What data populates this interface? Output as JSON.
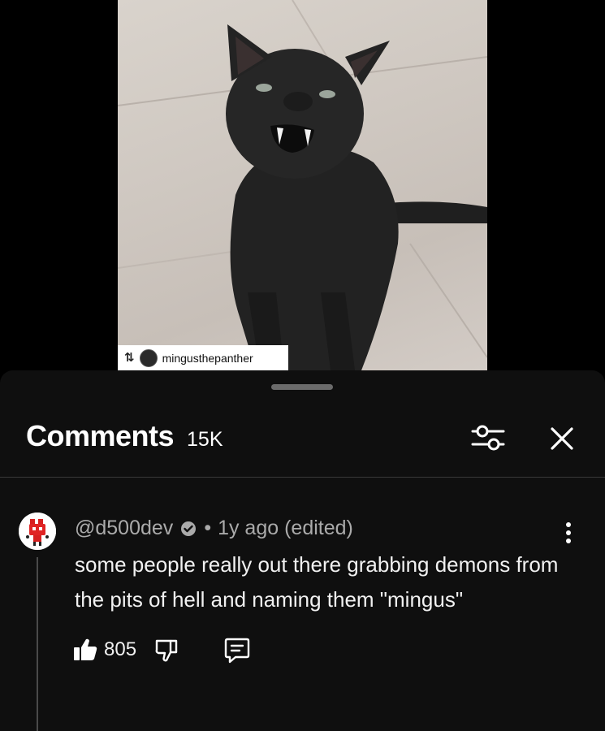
{
  "video": {
    "repost_username": "mingusthepanther",
    "repost_icon": "repost-icon"
  },
  "comments_panel": {
    "title": "Comments",
    "count": "15K",
    "filter_icon": "sliders-icon",
    "close_icon": "close-icon"
  },
  "comment": {
    "author": "@d500dev",
    "verified_icon": "verified-badge-icon",
    "separator": "•",
    "time": "1y ago (edited)",
    "text": "some people really out there grabbing demons from the pits of hell and naming them \"mingus\"",
    "likes": "805",
    "like_icon": "thumbs-up-filled-icon",
    "dislike_icon": "thumbs-down-icon",
    "reply_icon": "reply-comment-icon",
    "more_icon": "more-vertical-icon"
  },
  "colors": {
    "background": "#000000",
    "sheet": "#0f0f0f",
    "text_primary": "#f1f1f1",
    "text_secondary": "#aaaaaa"
  }
}
